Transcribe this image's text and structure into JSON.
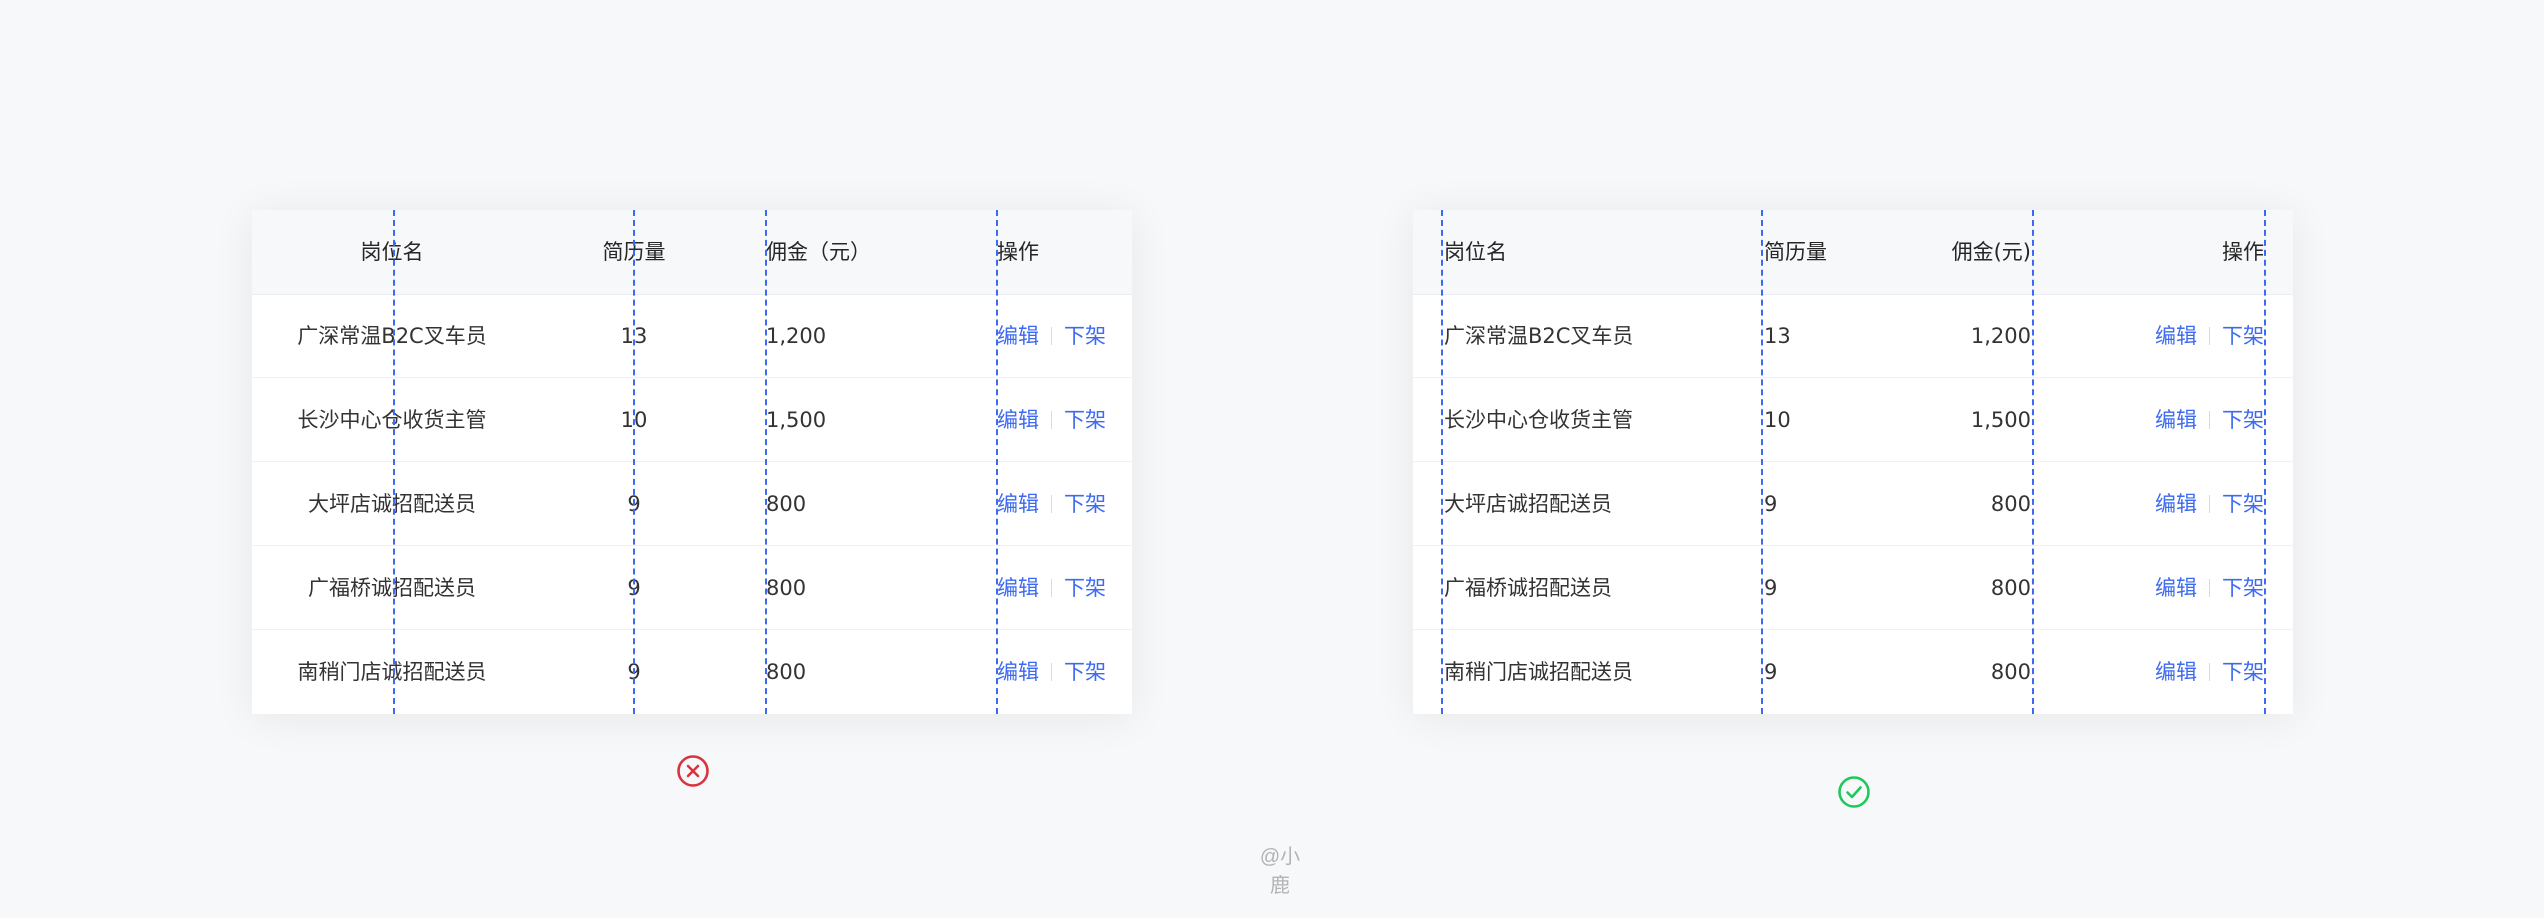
{
  "examples": [
    {
      "id": "incorrect",
      "columns": [
        "岗位名",
        "简历量",
        "佣金（元）",
        "操作"
      ],
      "rows": [
        {
          "name": "广深常温B2C叉车员",
          "resumes": "13",
          "commission": "1,200"
        },
        {
          "name": "长沙中心仓收货主管",
          "resumes": "10",
          "commission": "1,500"
        },
        {
          "name": "大坪店诚招配送员",
          "resumes": "9",
          "commission": "800"
        },
        {
          "name": "广福桥诚招配送员",
          "resumes": "9",
          "commission": "800"
        },
        {
          "name": "南稍门店诚招配送员",
          "resumes": "9",
          "commission": "800"
        }
      ],
      "actions": {
        "edit": "编辑",
        "off_shelf": "下架"
      },
      "status": "incorrect",
      "status_icon": "circle-x-icon",
      "status_color": "#d9333f"
    },
    {
      "id": "correct",
      "columns": [
        "岗位名",
        "简历量",
        "佣金(元)",
        "操作"
      ],
      "rows": [
        {
          "name": "广深常温B2C叉车员",
          "resumes": "13",
          "commission": "1,200"
        },
        {
          "name": "长沙中心仓收货主管",
          "resumes": "10",
          "commission": "1,500"
        },
        {
          "name": "大坪店诚招配送员",
          "resumes": "9",
          "commission": "800"
        },
        {
          "name": "广福桥诚招配送员",
          "resumes": "9",
          "commission": "800"
        },
        {
          "name": "南稍门店诚招配送员",
          "resumes": "9",
          "commission": "800"
        }
      ],
      "actions": {
        "edit": "编辑",
        "off_shelf": "下架"
      },
      "status": "correct",
      "status_icon": "circle-check-icon",
      "status_color": "#1fc85a"
    }
  ],
  "colors": {
    "link": "#3d6af2",
    "guide_line": "#3d6af2",
    "header_bg": "#f7f8fa",
    "page_bg": "#f7f8fa"
  },
  "watermark": "@小鹿"
}
